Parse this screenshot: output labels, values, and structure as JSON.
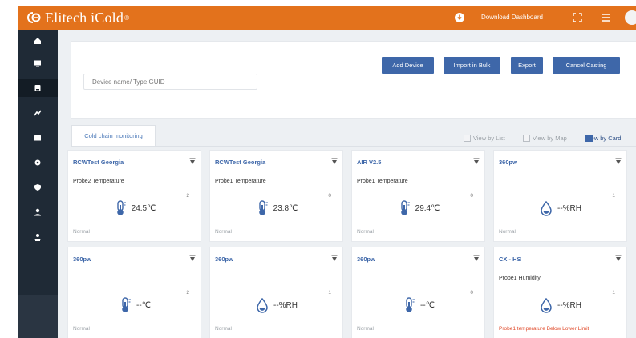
{
  "brand": {
    "name": "Elitech iCold",
    "reg": "®"
  },
  "header": {
    "download_label": "Download Dashboard"
  },
  "sidebar": {
    "items": [
      {
        "icon": "home-icon"
      },
      {
        "icon": "monitor-icon"
      },
      {
        "icon": "device-icon"
      },
      {
        "icon": "chart-icon"
      },
      {
        "icon": "database-icon"
      },
      {
        "icon": "settings-icon"
      },
      {
        "icon": "shield-icon"
      },
      {
        "icon": "user-icon"
      },
      {
        "icon": "users-icon"
      }
    ],
    "active_index": 2
  },
  "search": {
    "placeholder": "Device name/ Type GUID"
  },
  "actions": {
    "add": "Add Device",
    "import": "Import in Bulk",
    "export": "Export",
    "cancel": "Cancel Casting"
  },
  "tab": {
    "label": "Cold chain monitoring"
  },
  "views": {
    "list": "View by List",
    "map": "View by Map",
    "card": "View by Card"
  },
  "colors": {
    "brand": "#e3721c",
    "sidebar": "#1f2a36",
    "accent": "#3e67a9",
    "alarm": "#e04a2a"
  },
  "cards": [
    {
      "title": "RCWTest Georgia",
      "probe": "Probe2 Temperature",
      "count": "2",
      "icon": "thermometer-icon",
      "value": "24.5℃",
      "status": "Normal",
      "alarm": false
    },
    {
      "title": "RCWTest Georgia",
      "probe": "Probe1 Temperature",
      "count": "0",
      "icon": "thermometer-icon",
      "value": "23.8℃",
      "status": "Normal",
      "alarm": false
    },
    {
      "title": "AIR V2.5",
      "probe": "Probe1 Temperature",
      "count": "0",
      "icon": "thermometer-icon",
      "value": "29.4℃",
      "status": "Normal",
      "alarm": false
    },
    {
      "title": "360pw",
      "probe": "",
      "count": "1",
      "icon": "humidity-drop-icon",
      "value": "--%RH",
      "status": "Normal",
      "alarm": false
    },
    {
      "title": "360pw",
      "probe": "",
      "count": "2",
      "icon": "thermometer-icon",
      "value": "--℃",
      "status": "Normal",
      "alarm": false
    },
    {
      "title": "360pw",
      "probe": "",
      "count": "1",
      "icon": "humidity-drop-icon",
      "value": "--%RH",
      "status": "Normal",
      "alarm": false
    },
    {
      "title": "360pw",
      "probe": "",
      "count": "0",
      "icon": "thermometer-icon",
      "value": "--℃",
      "status": "Normal",
      "alarm": false
    },
    {
      "title": "CX - HS",
      "probe": "Probe1 Humidity",
      "count": "1",
      "icon": "humidity-drop-icon",
      "value": "--%RH",
      "status": "Probe1 temperature Below Lower Limit",
      "alarm": true
    }
  ]
}
